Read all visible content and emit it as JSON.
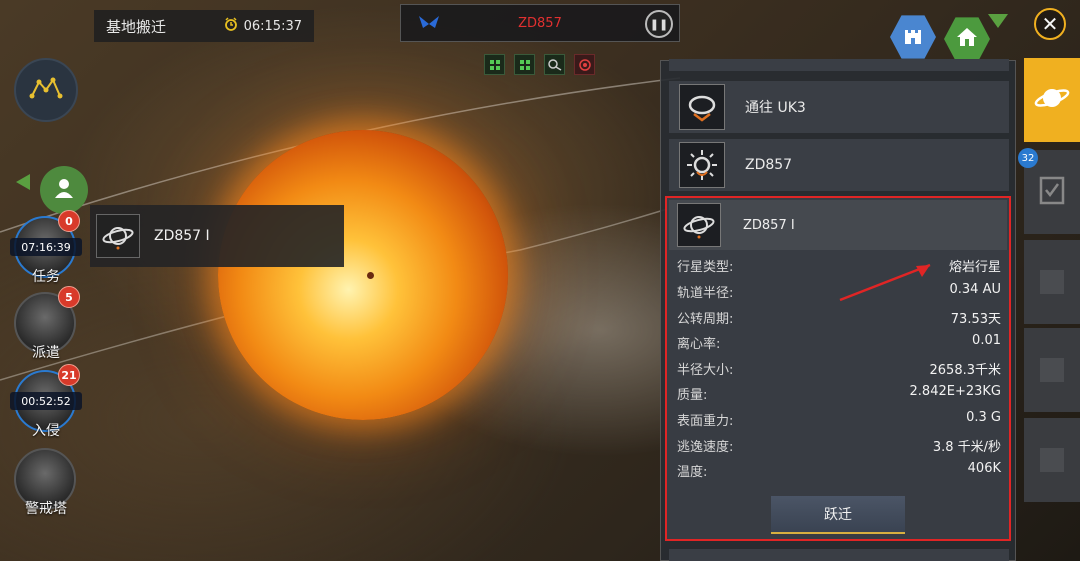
{
  "top_bar": {
    "mission_title": "基地搬迁",
    "mission_time": "06:15:37",
    "system_code": "ZD857"
  },
  "status_icons": [
    "grid-icon",
    "grid-icon",
    "radar-icon",
    "target-icon"
  ],
  "left_menu": [
    {
      "label": "任务",
      "badge": "0",
      "timer": "07:16:39"
    },
    {
      "label": "派遣",
      "badge": "5",
      "timer": ""
    },
    {
      "label": "入侵",
      "badge": "21",
      "timer": "00:52:52"
    },
    {
      "label": "警戒塔",
      "badge": "",
      "timer": ""
    }
  ],
  "selected_body_label": "ZD857 I",
  "panel": {
    "list": [
      {
        "name": "通往 UK3"
      },
      {
        "name": "ZD857"
      }
    ],
    "detail": {
      "name": "ZD857 I",
      "attributes": [
        {
          "label": "行星类型:",
          "value": "熔岩行星"
        },
        {
          "label": "轨道半径:",
          "value": "0.34 AU"
        },
        {
          "label": "公转周期:",
          "value": "73.53天"
        },
        {
          "label": "离心率:",
          "value": "0.01"
        },
        {
          "label": "半径大小:",
          "value": "2658.3千米"
        },
        {
          "label": "质量:",
          "value": "2.842E+23KG"
        },
        {
          "label": "表面重力:",
          "value": "0.3 G"
        },
        {
          "label": "逃逸速度:",
          "value": "3.8 千米/秒"
        },
        {
          "label": "温度:",
          "value": "406K"
        }
      ],
      "jump_button": "跃迁"
    }
  },
  "right_tabs": {
    "badge": "32"
  },
  "colors": {
    "accent": "#f0b020",
    "highlight_border": "#e02525",
    "alert": "#e03030"
  }
}
